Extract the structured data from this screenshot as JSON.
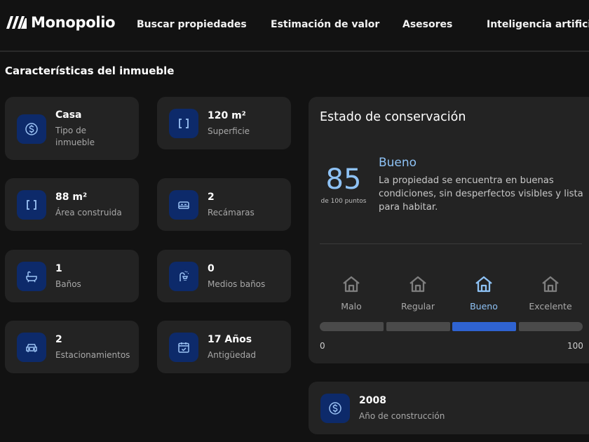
{
  "brand": {
    "name": "Monopolio"
  },
  "nav": {
    "links": [
      "Buscar propiedades",
      "Estimación de valor",
      "Asesores",
      "Inteligencia artificial"
    ]
  },
  "section": {
    "title": "Características del inmueble"
  },
  "features": [
    {
      "value": "Casa",
      "label": "Tipo de inmueble",
      "icon": "dollar-icon"
    },
    {
      "value": "120 m²",
      "label": "Superficie",
      "icon": "brackets-icon"
    },
    {
      "value": "88 m²",
      "label": "Área construida",
      "icon": "brackets-icon"
    },
    {
      "value": "2",
      "label": "Recámaras",
      "icon": "bed-icon"
    },
    {
      "value": "1",
      "label": "Baños",
      "icon": "bathtub-icon"
    },
    {
      "value": "0",
      "label": "Medios baños",
      "icon": "shower-icon"
    },
    {
      "value": "2",
      "label": "Estacionamientos",
      "icon": "car-icon"
    },
    {
      "value": "17 Años",
      "label": "Antigüedad",
      "icon": "calendar-check-icon"
    }
  ],
  "conservation": {
    "title": "Estado de conservación",
    "score": "85",
    "score_sub": "de 100 puntos",
    "state": "Bueno",
    "description": "La propiedad se encuentra en buenas condiciones, sin desperfectos visibles y lista para habitar.",
    "levels": [
      "Malo",
      "Regular",
      "Bueno",
      "Excelente"
    ],
    "active_level": 2,
    "scale_min": "0",
    "scale_max": "100"
  },
  "year": {
    "value": "2008",
    "label": "Año de construcción",
    "icon": "dollar-icon"
  },
  "colors": {
    "accent": "#8ec2f5",
    "active_bar": "#2f63d1",
    "icon_bg": "#0d2a6a"
  }
}
